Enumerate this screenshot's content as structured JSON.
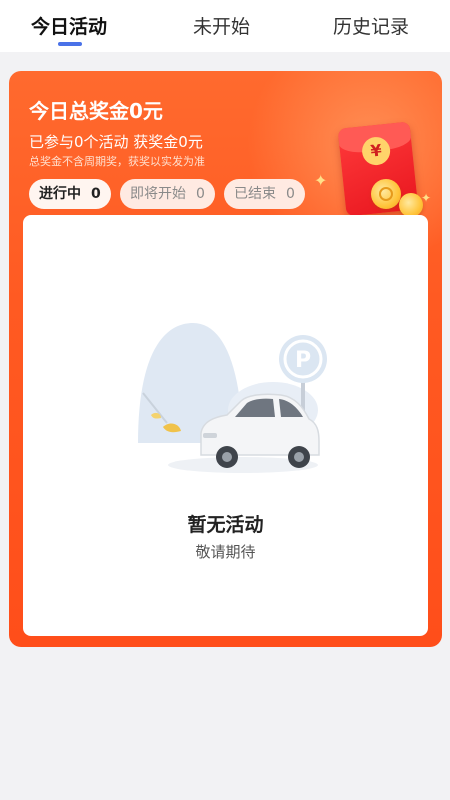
{
  "tabs": {
    "today": "今日活动",
    "upcoming": "未开始",
    "history": "历史记录"
  },
  "card": {
    "title": "今日总奖金0元",
    "summary": "已参与0个活动 获奖金0元",
    "note": "总奖金不含周期奖，获奖以实发为准",
    "envelope_symbol": "¥"
  },
  "chips": [
    {
      "label": "进行中",
      "count": "0"
    },
    {
      "label": "即将开始",
      "count": "0"
    },
    {
      "label": "已结束",
      "count": "0"
    }
  ],
  "empty_state": {
    "title": "暂无活动",
    "subtitle": "敬请期待",
    "illustration_icon": "parked-car-illustration",
    "sign_letter": "P"
  },
  "colors": {
    "accent_orange": "#ff5a22",
    "tab_indicator": "#4a72e8",
    "envelope_red": "#e8161f"
  }
}
